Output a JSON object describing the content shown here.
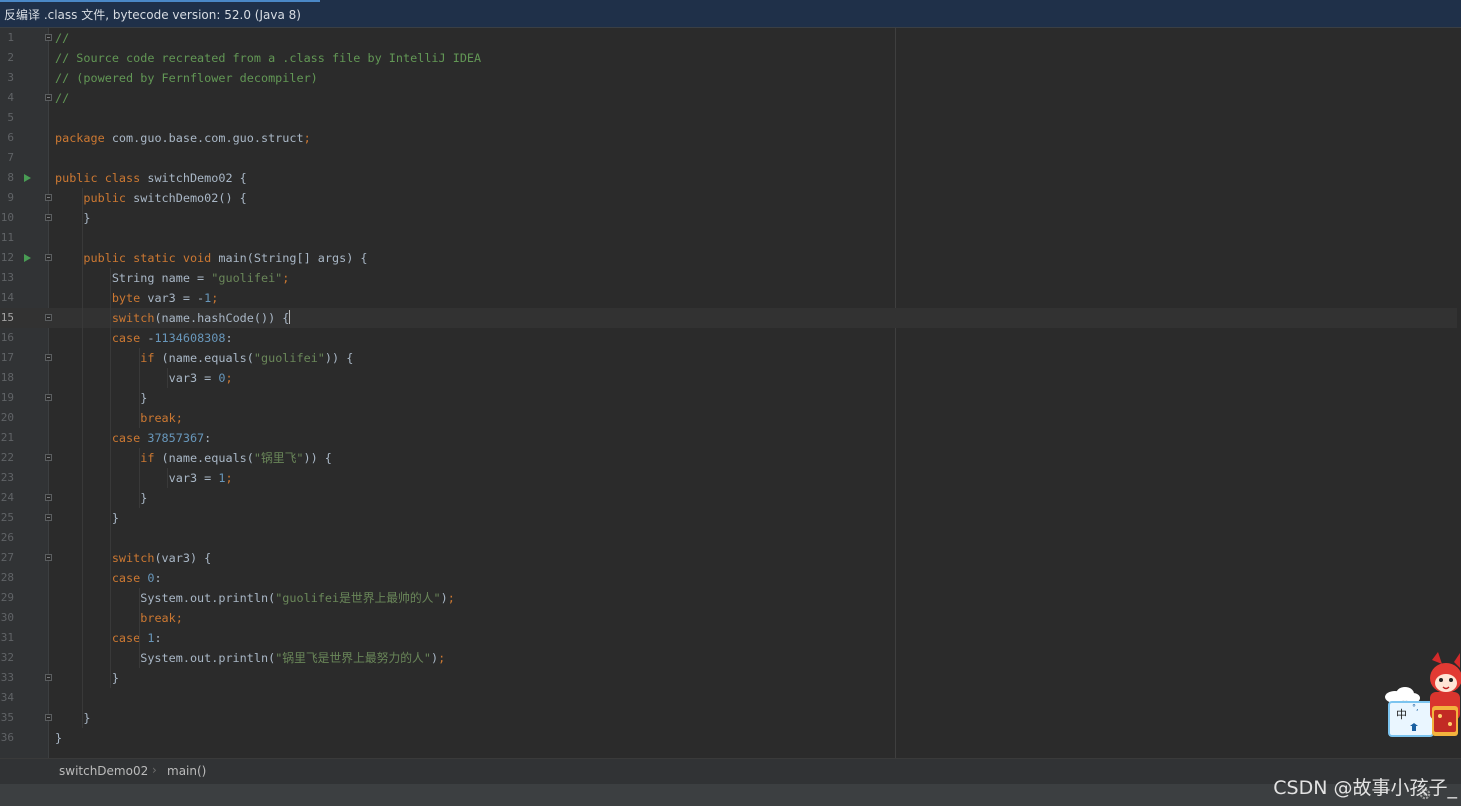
{
  "info_bar": {
    "text": "反编译 .class 文件, bytecode version: 52.0 (Java 8)"
  },
  "editor": {
    "current_line": 15,
    "lines": [
      {
        "n": "1",
        "tokens": [
          [
            "cm",
            "//"
          ]
        ]
      },
      {
        "n": "2",
        "tokens": [
          [
            "cm",
            "// Source code recreated from a .class file by IntelliJ IDEA"
          ]
        ]
      },
      {
        "n": "3",
        "tokens": [
          [
            "cm",
            "// (powered by Fernflower decompiler)"
          ]
        ]
      },
      {
        "n": "4",
        "tokens": [
          [
            "cm",
            "//"
          ]
        ]
      },
      {
        "n": "5",
        "tokens": []
      },
      {
        "n": "6",
        "tokens": [
          [
            "kw",
            "package "
          ],
          [
            "plain",
            "com.guo.base.com.guo.struct"
          ],
          [
            "kw",
            ";"
          ]
        ]
      },
      {
        "n": "7",
        "tokens": []
      },
      {
        "n": "8",
        "tokens": [
          [
            "kw",
            "public class "
          ],
          [
            "plain",
            "switchDemo02 {"
          ]
        ]
      },
      {
        "n": "9",
        "tokens": [
          [
            "plain",
            "    "
          ],
          [
            "kw",
            "public "
          ],
          [
            "plain",
            "switchDemo02() {"
          ]
        ]
      },
      {
        "n": "10",
        "tokens": [
          [
            "plain",
            "    }"
          ]
        ]
      },
      {
        "n": "11",
        "tokens": []
      },
      {
        "n": "12",
        "tokens": [
          [
            "plain",
            "    "
          ],
          [
            "kw",
            "public static void "
          ],
          [
            "plain",
            "main(String[] args) {"
          ]
        ]
      },
      {
        "n": "13",
        "tokens": [
          [
            "plain",
            "        String name = "
          ],
          [
            "str",
            "\"guolifei\""
          ],
          [
            "kw",
            ";"
          ]
        ]
      },
      {
        "n": "14",
        "tokens": [
          [
            "plain",
            "        "
          ],
          [
            "kw",
            "byte "
          ],
          [
            "plain",
            "var3 = -"
          ],
          [
            "num",
            "1"
          ],
          [
            "kw",
            ";"
          ]
        ]
      },
      {
        "n": "15",
        "tokens": [
          [
            "plain",
            "        "
          ],
          [
            "kw",
            "switch"
          ],
          [
            "plain",
            "(name.hashCode()) {"
          ]
        ]
      },
      {
        "n": "16",
        "tokens": [
          [
            "plain",
            "        "
          ],
          [
            "kw",
            "case "
          ],
          [
            "plain",
            "-"
          ],
          [
            "num",
            "1134608308"
          ],
          [
            "plain",
            ":"
          ]
        ]
      },
      {
        "n": "17",
        "tokens": [
          [
            "plain",
            "            "
          ],
          [
            "kw",
            "if "
          ],
          [
            "plain",
            "(name.equals("
          ],
          [
            "str",
            "\"guolifei\""
          ],
          [
            "plain",
            ")) {"
          ]
        ]
      },
      {
        "n": "18",
        "tokens": [
          [
            "plain",
            "                var3 = "
          ],
          [
            "num",
            "0"
          ],
          [
            "kw",
            ";"
          ]
        ]
      },
      {
        "n": "19",
        "tokens": [
          [
            "plain",
            "            }"
          ]
        ]
      },
      {
        "n": "20",
        "tokens": [
          [
            "plain",
            "            "
          ],
          [
            "kw",
            "break;"
          ]
        ]
      },
      {
        "n": "21",
        "tokens": [
          [
            "plain",
            "        "
          ],
          [
            "kw",
            "case "
          ],
          [
            "num",
            "37857367"
          ],
          [
            "plain",
            ":"
          ]
        ]
      },
      {
        "n": "22",
        "tokens": [
          [
            "plain",
            "            "
          ],
          [
            "kw",
            "if "
          ],
          [
            "plain",
            "(name.equals("
          ],
          [
            "str",
            "\"锅里飞\""
          ],
          [
            "plain",
            ")) {"
          ]
        ]
      },
      {
        "n": "23",
        "tokens": [
          [
            "plain",
            "                var3 = "
          ],
          [
            "num",
            "1"
          ],
          [
            "kw",
            ";"
          ]
        ]
      },
      {
        "n": "24",
        "tokens": [
          [
            "plain",
            "            }"
          ]
        ]
      },
      {
        "n": "25",
        "tokens": [
          [
            "plain",
            "        }"
          ]
        ]
      },
      {
        "n": "26",
        "tokens": []
      },
      {
        "n": "27",
        "tokens": [
          [
            "plain",
            "        "
          ],
          [
            "kw",
            "switch"
          ],
          [
            "plain",
            "(var3) {"
          ]
        ]
      },
      {
        "n": "28",
        "tokens": [
          [
            "plain",
            "        "
          ],
          [
            "kw",
            "case "
          ],
          [
            "num",
            "0"
          ],
          [
            "plain",
            ":"
          ]
        ]
      },
      {
        "n": "29",
        "tokens": [
          [
            "plain",
            "            System.out.println("
          ],
          [
            "str",
            "\"guolifei是世界上最帅的人\""
          ],
          [
            "plain",
            ")"
          ],
          [
            "kw",
            ";"
          ]
        ]
      },
      {
        "n": "30",
        "tokens": [
          [
            "plain",
            "            "
          ],
          [
            "kw",
            "break;"
          ]
        ]
      },
      {
        "n": "31",
        "tokens": [
          [
            "plain",
            "        "
          ],
          [
            "kw",
            "case "
          ],
          [
            "num",
            "1"
          ],
          [
            "plain",
            ":"
          ]
        ]
      },
      {
        "n": "32",
        "tokens": [
          [
            "plain",
            "            System.out.println("
          ],
          [
            "str",
            "\"锅里飞是世界上最努力的人\""
          ],
          [
            "plain",
            ")"
          ],
          [
            "kw",
            ";"
          ]
        ]
      },
      {
        "n": "33",
        "tokens": [
          [
            "plain",
            "        }"
          ]
        ]
      },
      {
        "n": "34",
        "tokens": []
      },
      {
        "n": "35",
        "tokens": [
          [
            "plain",
            "    }"
          ]
        ]
      },
      {
        "n": "36",
        "tokens": [
          [
            "plain",
            "}"
          ]
        ]
      }
    ],
    "run_gutter_lines": [
      8,
      12
    ],
    "fold_gutter_lines": [
      1,
      4,
      9,
      10,
      12,
      15,
      17,
      19,
      22,
      24,
      25,
      27,
      33,
      35
    ]
  },
  "breadcrumb": {
    "class_name": "switchDemo02",
    "separator": "›",
    "method_name": "main()"
  },
  "ime": {
    "label": "中"
  },
  "watermark": {
    "text": "CSDN @故事小孩子_"
  },
  "colors": {
    "keyword": "#cc7832",
    "comment": "#629755",
    "string": "#6a8759",
    "number": "#6897bb",
    "plain": "#a9b7c6",
    "background": "#2b2b2b",
    "gutter": "#313335",
    "run_icon": "#499c54"
  }
}
